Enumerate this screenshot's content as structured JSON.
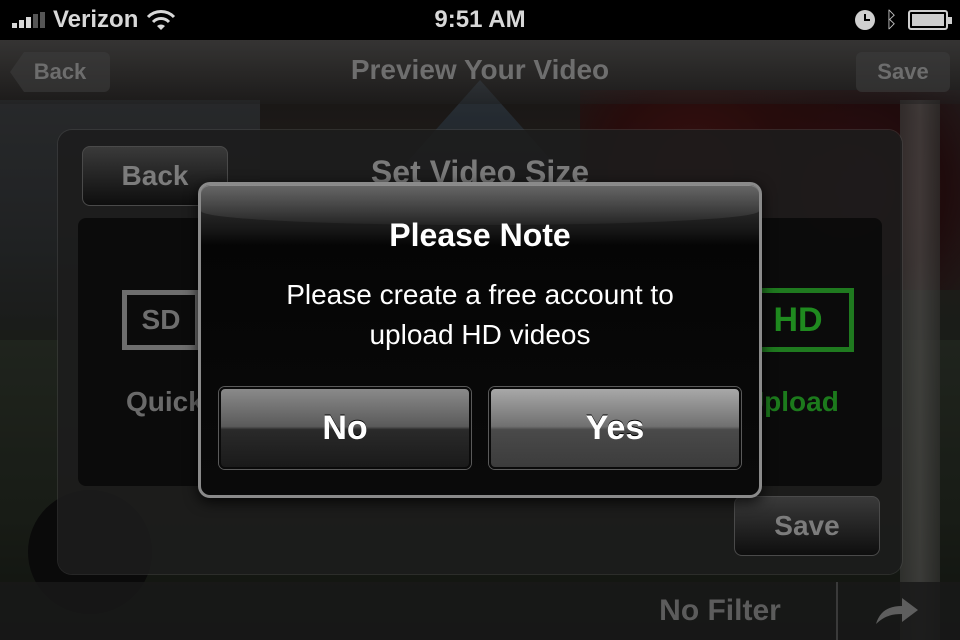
{
  "status_bar": {
    "carrier": "Verizon",
    "time": "9:51 AM",
    "icons": [
      "signal-icon",
      "wifi-icon",
      "clock-icon",
      "bluetooth-icon",
      "battery-charging-icon"
    ]
  },
  "navbar": {
    "back_label": "Back",
    "title": "Preview Your Video",
    "save_label": "Save"
  },
  "panel": {
    "back_label": "Back",
    "title": "Set Video Size",
    "sd_label": "SD",
    "hd_label": "HD",
    "quick_label": "Quick Upload",
    "wifi_label": "Wi-Fi Upload",
    "save_label": "Save",
    "selected": "HD"
  },
  "alert": {
    "title": "Please Note",
    "message_line1": "Please create a free account to",
    "message_line2": "upload HD videos",
    "no_label": "No",
    "yes_label": "Yes"
  },
  "bottom_bar": {
    "filter_label": "No Filter",
    "share_icon": "share-arrow-icon"
  },
  "colors": {
    "hd_green": "#1f8a1f",
    "alert_border": "#8a8a8a",
    "dim_text": "#6e6e6e"
  }
}
